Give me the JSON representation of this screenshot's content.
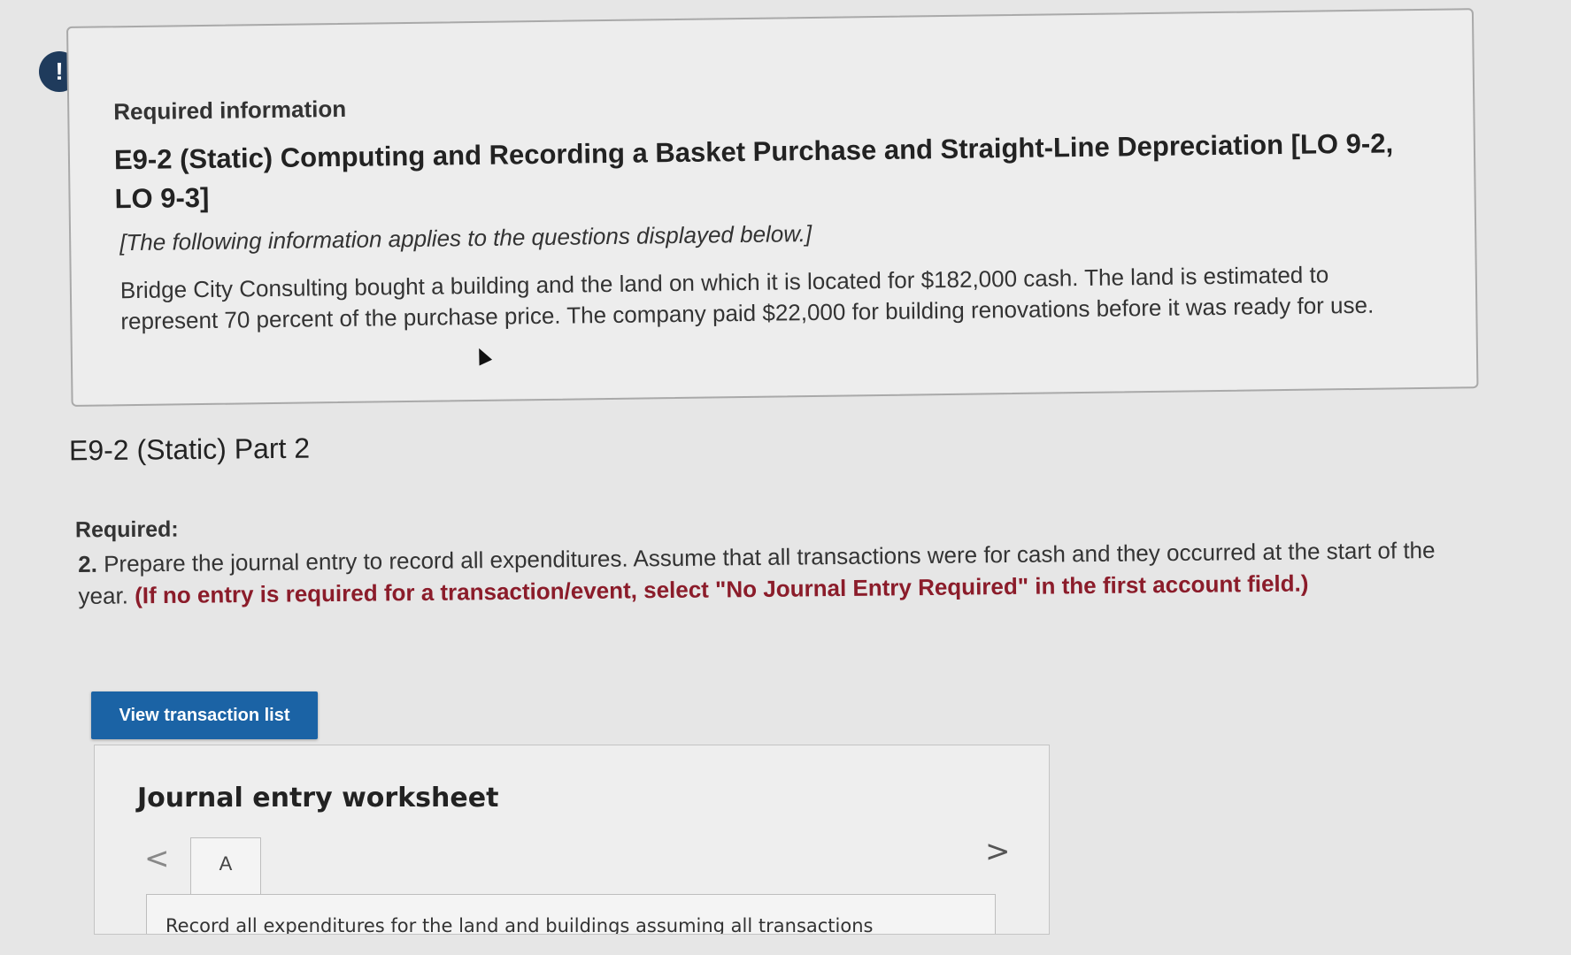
{
  "alert": {
    "icon": "!"
  },
  "info": {
    "required_label": "Required information",
    "title": "E9-2 (Static) Computing and Recording a Basket Purchase and Straight-Line Depreciation [LO 9-2, LO 9-3]",
    "note": "[The following information applies to the questions displayed below.]",
    "body": "Bridge City Consulting bought a building and the land on which it is located for $182,000 cash. The land is estimated to represent 70 percent of the purchase price. The company paid $22,000 for building renovations before it was ready for use."
  },
  "part": {
    "title": "E9-2 (Static) Part 2",
    "required_label": "Required:",
    "question_number": "2.",
    "question_text": "Prepare the journal entry to record all expenditures. Assume that all transactions were for cash and they occurred at the start of the year.",
    "question_hint": "(If no entry is required for a transaction/event, select \"No Journal Entry Required\" in the first account field.)"
  },
  "buttons": {
    "view_transactions": "View transaction list"
  },
  "worksheet": {
    "title": "Journal entry worksheet",
    "prev_icon": "<",
    "next_icon": ">",
    "tabs": [
      "A"
    ],
    "instruction": "Record all expenditures for the land and buildings assuming all transactions"
  },
  "colors": {
    "button_bg": "#1b63a5",
    "hint_text": "#8b1c2a",
    "alert_bg": "#1f3b5c"
  }
}
